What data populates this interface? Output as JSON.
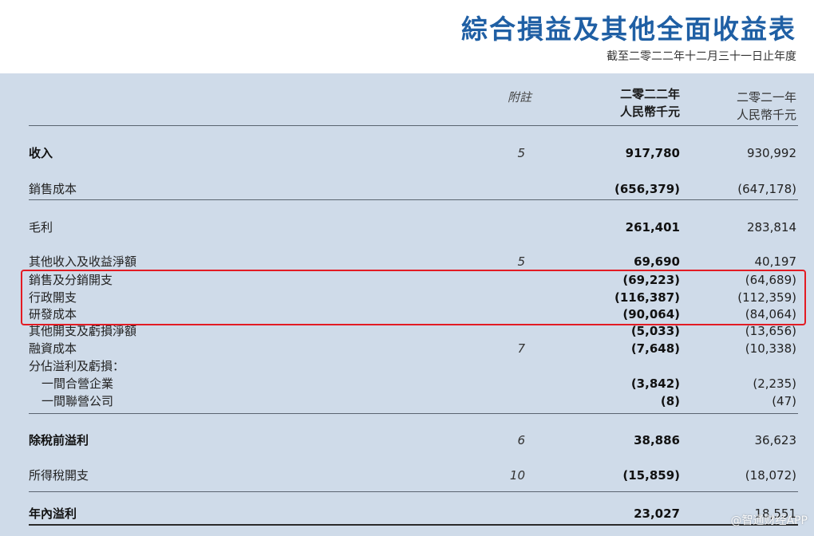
{
  "header": {
    "title": "綜合損益及其他全面收益表",
    "subtitle": "截至二零二二年十二月三十一日止年度"
  },
  "columns": {
    "note": "附註",
    "year_2022": "二零二二年",
    "currency_2022": "人民幣千元",
    "year_2021": "二零二一年",
    "currency_2021": "人民幣千元"
  },
  "rows": [
    {
      "label": "收入",
      "note": "5",
      "v2022": "917,780",
      "v2021": "930,992"
    },
    {
      "label": "銷售成本",
      "note": "",
      "v2022": "(656,379)",
      "v2021": "(647,178)"
    },
    {
      "label": "毛利",
      "note": "",
      "v2022": "261,401",
      "v2021": "283,814"
    },
    {
      "label": "其他收入及收益淨額",
      "note": "5",
      "v2022": "69,690",
      "v2021": "40,197"
    },
    {
      "label": "銷售及分銷開支",
      "note": "",
      "v2022": "(69,223)",
      "v2021": "(64,689)"
    },
    {
      "label": "行政開支",
      "note": "",
      "v2022": "(116,387)",
      "v2021": "(112,359)"
    },
    {
      "label": "研發成本",
      "note": "",
      "v2022": "(90,064)",
      "v2021": "(84,064)"
    },
    {
      "label": "其他開支及虧損淨額",
      "note": "",
      "v2022": "(5,033)",
      "v2021": "(13,656)"
    },
    {
      "label": "融資成本",
      "note": "7",
      "v2022": "(7,648)",
      "v2021": "(10,338)"
    },
    {
      "label": "分佔溢利及虧損：",
      "note": "",
      "v2022": "",
      "v2021": ""
    },
    {
      "label": "一間合營企業",
      "note": "",
      "v2022": "(3,842)",
      "v2021": "(2,235)"
    },
    {
      "label": "一間聯營公司",
      "note": "",
      "v2022": "(8)",
      "v2021": "(47)"
    },
    {
      "label": "除稅前溢利",
      "note": "6",
      "v2022": "38,886",
      "v2021": "36,623"
    },
    {
      "label": "所得稅開支",
      "note": "10",
      "v2022": "(15,859)",
      "v2021": "(18,072)"
    },
    {
      "label": "年內溢利",
      "note": "",
      "v2022": "23,027",
      "v2021": "18,551"
    }
  ],
  "watermark": "@智通财经APP",
  "colors": {
    "title": "#1f5fa4",
    "panel": "#cfdbe9",
    "highlight": "#e31b23"
  }
}
